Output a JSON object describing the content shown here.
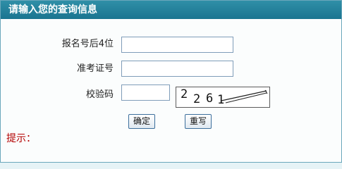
{
  "header": {
    "title": "请输入您的查询信息"
  },
  "form": {
    "fields": [
      {
        "label": "报名号后4位",
        "value": "",
        "placeholder": ""
      },
      {
        "label": "准考证号",
        "value": "",
        "placeholder": ""
      },
      {
        "label": "校验码",
        "value": "",
        "placeholder": ""
      }
    ],
    "captcha": {
      "text": "2261"
    }
  },
  "buttons": {
    "confirm": "确定",
    "reset": "重写"
  },
  "hint": {
    "label": "提示："
  },
  "colors": {
    "header": "#1f7f99",
    "hint": "#b30000",
    "border": "#6aa7bb"
  }
}
